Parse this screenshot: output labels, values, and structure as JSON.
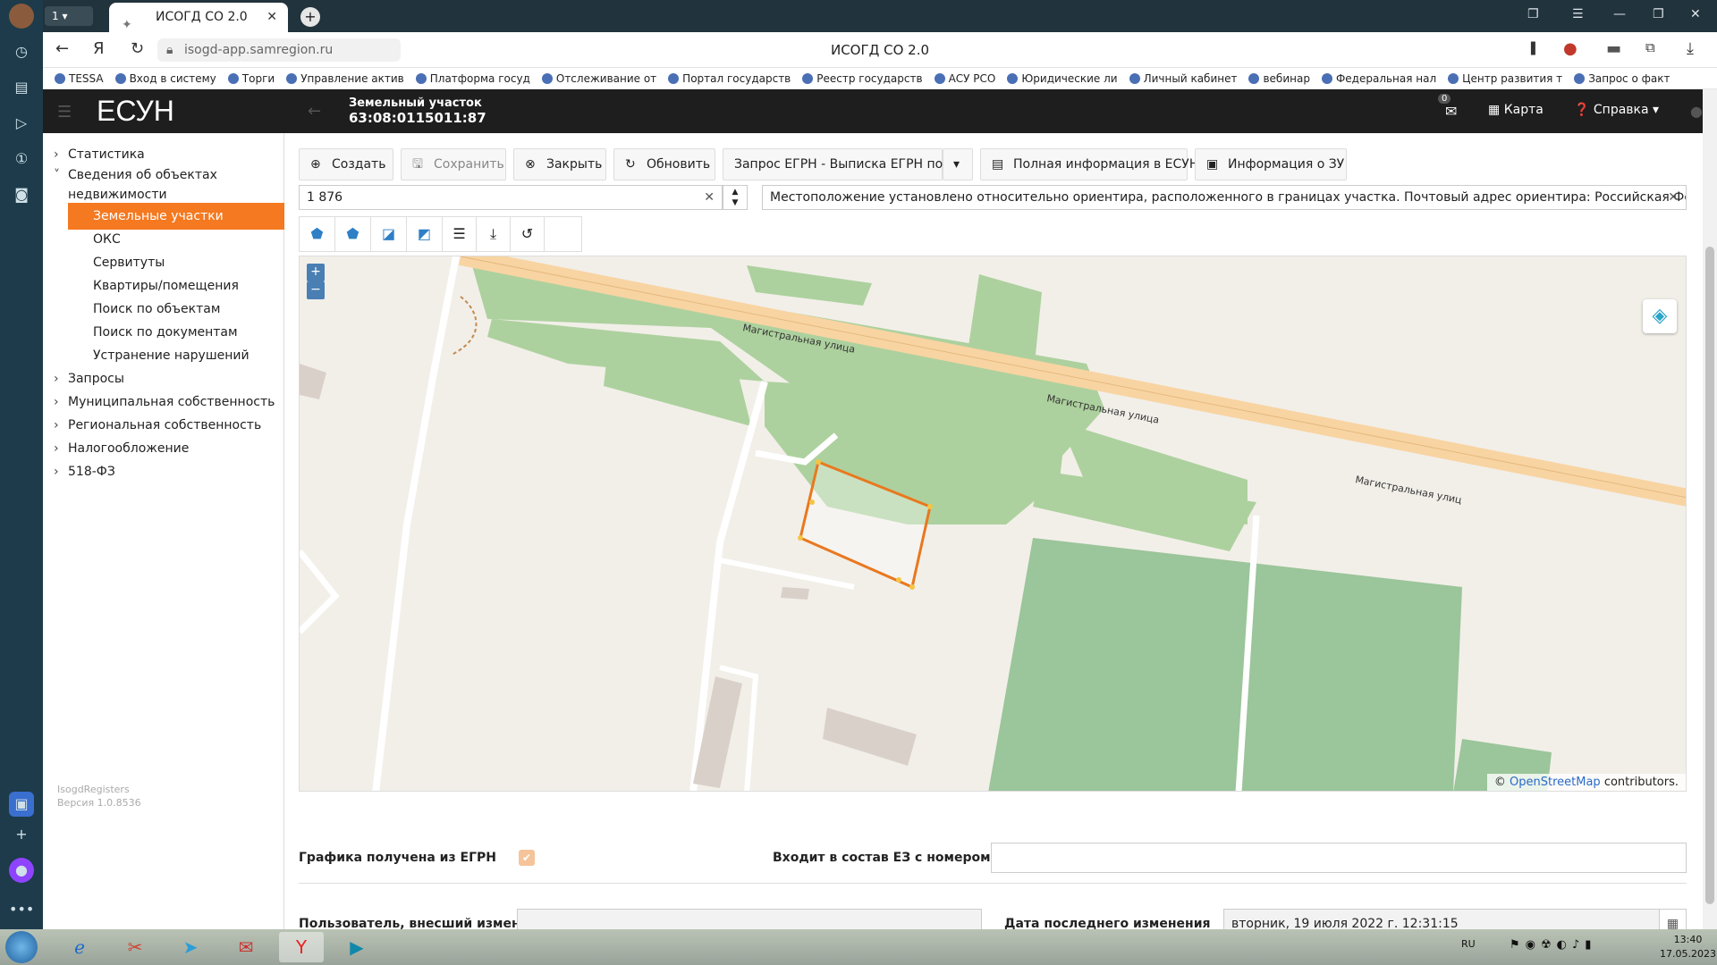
{
  "browser": {
    "tab_title": "ИСОГД СО 2.0",
    "tab_badge": "1",
    "url": "isogd-app.samregion.ru",
    "page_title": "ИСОГД СО 2.0",
    "bookmarks": [
      "TESSA",
      "Вход в систему",
      "Торги",
      "Управление актив",
      "Платформа госуд",
      "Отслеживание от",
      "Портал государств",
      "Реестр государств",
      "АСУ РСО",
      "Юридические ли",
      "Личный кабинет",
      "вебинар",
      "Федеральная нал",
      "Центр развития т",
      "Запрос о факт"
    ]
  },
  "app": {
    "brand": "ЕСУН",
    "entity_type": "Земельный участок",
    "entity_number": "63:08:0115011:87",
    "mail_count": "0",
    "map_link": "Карта",
    "help_link": "Справка"
  },
  "sidebar": {
    "top": [
      {
        "label": "Статистика"
      },
      {
        "label": "Сведения об объектах"
      },
      {
        "label": "недвижимости"
      }
    ],
    "sub": [
      "Земельные участки",
      "ОКС",
      "Сервитуты",
      "Квартиры/помещения",
      "Поиск по объектам",
      "Поиск по документам",
      "Устранение нарушений"
    ],
    "groups": [
      "Запросы",
      "Муниципальная собственность",
      "Региональная собственность",
      "Налогообложение",
      "518-ФЗ"
    ],
    "footer_app": "IsogdRegisters",
    "footer_version": "Версия 1.0.8536"
  },
  "toolbar": {
    "create": "Создать",
    "save": "Сохранить",
    "close": "Закрыть",
    "refresh": "Обновить",
    "egrn": "Запрос ЕГРН - Выписка ЕГРН по ЗУ",
    "full_info": "Полная информация в ЕСУН",
    "zu_info": "Информация о ЗУ"
  },
  "fields": {
    "area": "1 876",
    "location": "Местоположение установлено относительно ориентира, расположенного в границах участка. Почтовый адрес ориентира: Российская Федерация, Са..."
  },
  "map": {
    "street_1": "Магистральная улица",
    "street_2": "Магистральная улица",
    "street_3": "Магистральная улиц",
    "attrib_prefix": "©",
    "attrib_link": "OpenStreetMap",
    "attrib_suffix": "contributors.",
    "zoom_in": "+",
    "zoom_out": "−"
  },
  "form": {
    "graphics_label": "Графика получена из ЕГРН",
    "ez_label": "Входит в состав ЕЗ с номером",
    "user_label": "Пользователь, внесший изменения",
    "date_label": "Дата последнего изменения",
    "date_value": "вторник, 19 июля 2022 г. 12:31:15"
  },
  "taskbar": {
    "lang": "RU",
    "time": "13:40",
    "date": "17.05.2023"
  }
}
